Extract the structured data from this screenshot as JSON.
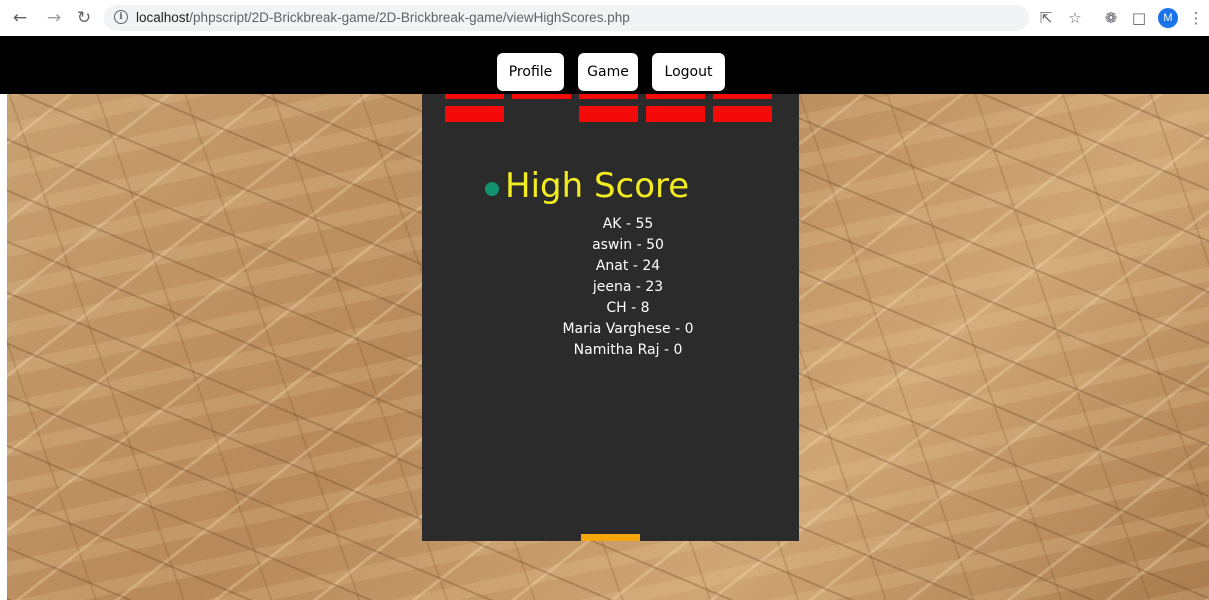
{
  "browser": {
    "url_host": "localhost",
    "url_path": "/phpscript/2D-Brickbreak-game/2D-Brickbreak-game/viewHighScores.php",
    "avatar_initial": "M",
    "icons": [
      "back-arrow-icon",
      "forward-arrow-icon",
      "reload-icon",
      "info-icon",
      "share-icon",
      "bookmark-star-icon",
      "extensions-puzzle-icon",
      "side-panel-icon",
      "kebab-menu-icon"
    ]
  },
  "nav": {
    "profile": "Profile",
    "game": "Game",
    "logout": "Logout"
  },
  "game": {
    "title": "High Score",
    "colors": {
      "board": "#2b2b2b",
      "brick": "#f50a0a",
      "ball": "#139270",
      "title": "#f3ec21",
      "paddle": "#f5a60b"
    },
    "bricks_visible": [
      [
        true,
        true,
        true,
        true,
        true
      ],
      [
        true,
        false,
        true,
        true,
        true
      ]
    ],
    "scores": [
      {
        "text": "AK - 55"
      },
      {
        "text": "aswin - 50"
      },
      {
        "text": "Anat - 24"
      },
      {
        "text": "jeena - 23"
      },
      {
        "text": "CH - 8"
      },
      {
        "text": "Maria Varghese - 0"
      },
      {
        "text": "Namitha Raj - 0"
      }
    ]
  }
}
